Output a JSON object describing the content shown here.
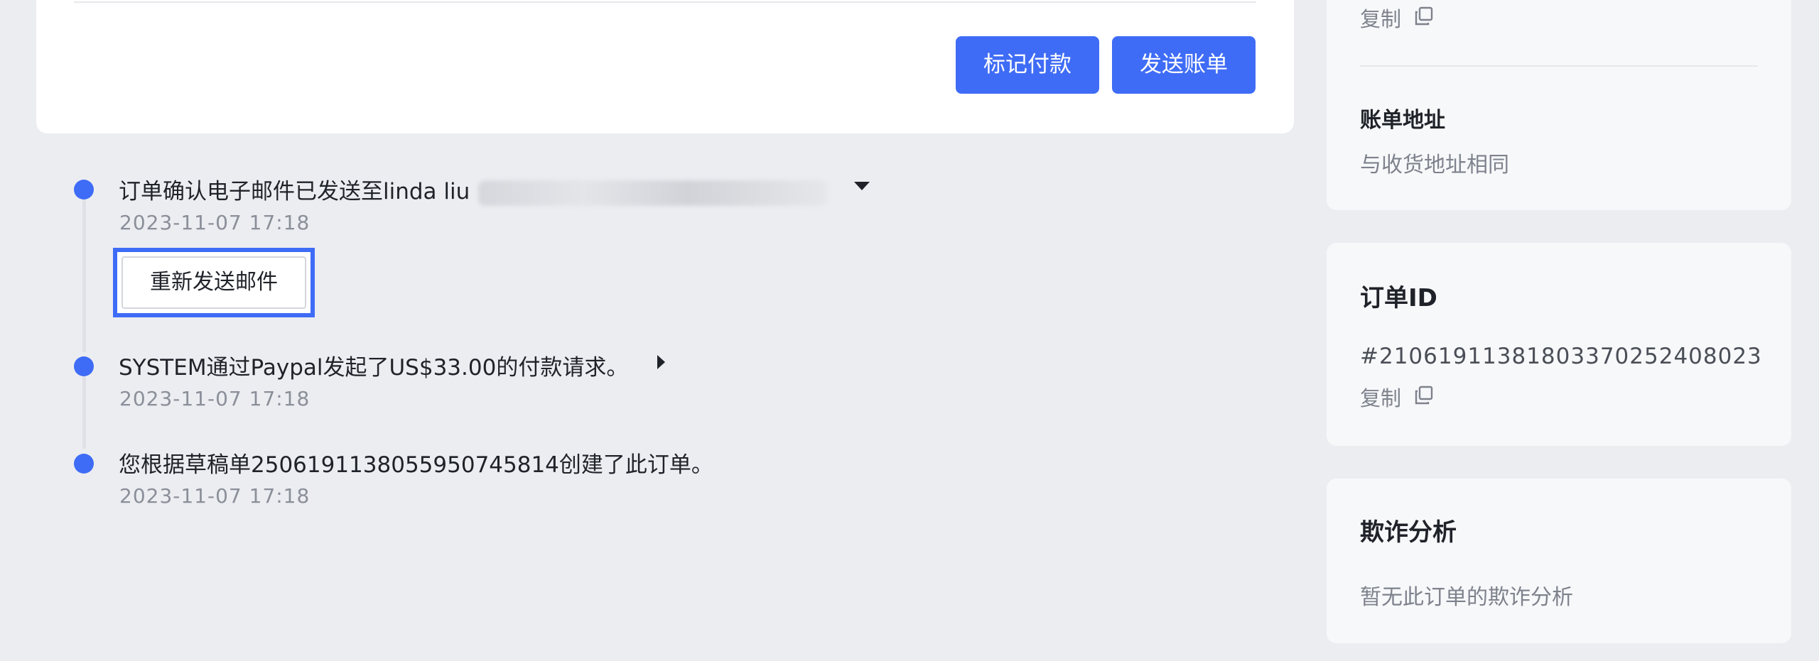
{
  "actions": {
    "mark_paid": "标记付款",
    "send_bill": "发送账单"
  },
  "timeline": [
    {
      "title": "订单确认电子邮件已发送至linda liu",
      "time": "2023-11-07 17:18",
      "button": "重新发送邮件"
    },
    {
      "title": "SYSTEM通过Paypal发起了US$33.00的付款请求。",
      "time": "2023-11-07 17:18"
    },
    {
      "title": "您根据草稿单250619113805595074581​4创建了此订单。",
      "time": "2023-11-07 17:18"
    }
  ],
  "billing": {
    "copy_label": "复制",
    "title": "账单地址",
    "value": "与收货地址相同"
  },
  "order": {
    "title": "订单ID",
    "id": "#210619113818033702524080​23",
    "copy_label": "复制"
  },
  "fraud": {
    "title": "欺诈分析",
    "value": "暂无此订单的欺诈分析"
  },
  "colors": {
    "accent": "#3f6cf6",
    "background": "#ecedf1"
  },
  "icons": [
    "copy-icon",
    "caret-down-icon",
    "caret-right-icon"
  ]
}
